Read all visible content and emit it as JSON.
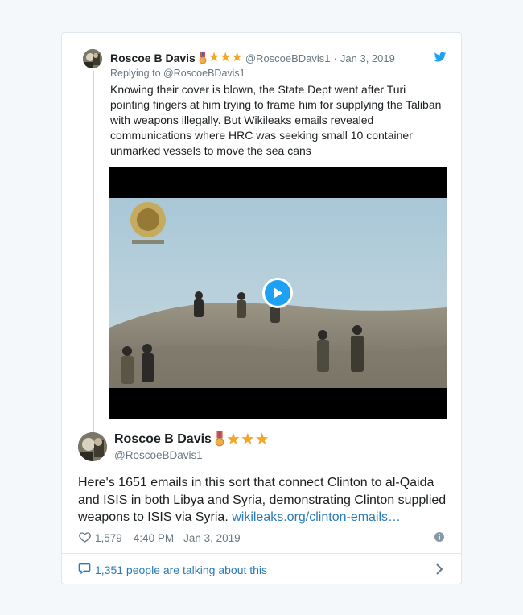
{
  "reply_tweet": {
    "author_name": "Roscoe B Davis",
    "handle": "@RoscoeBDavis1",
    "separator": "·",
    "date": "Jan 3, 2019",
    "replying_to": "Replying to @RoscoeBDavis1",
    "text": "Knowing their cover is blown, the State Dept went after Turi pointing  fingers at him trying to frame him for supplying the Taliban with weapons illegally. But Wikileaks emails revealed communications where  HRC was seeking small 10 container unmarked vessels to move the sea cans",
    "stars": "★★★"
  },
  "main_tweet": {
    "author_name": "Roscoe B Davis",
    "handle": "@RoscoeBDavis1",
    "stars": "★★★",
    "text": "Here's 1651 emails in this sort that connect Clinton to al-Qaida and ISIS in both Libya and Syria, demonstrating Clinton supplied weapons to ISIS via Syria. ",
    "link_text": "wikileaks.org/clinton-emails…",
    "likes": "1,579",
    "timestamp": "4:40 PM - Jan 3, 2019"
  },
  "footer": {
    "talking_label": "1,351 people are talking about this"
  },
  "icons": {
    "brand": "twitter-bird-icon",
    "like": "heart-icon",
    "info": "info-icon",
    "reply": "speech-bubble-icon",
    "more": "chevron-right-icon",
    "media": "play-icon"
  },
  "colors": {
    "accent": "#1da1f2",
    "link": "#2b7bb9",
    "star": "#f5a623",
    "muted": "#697882"
  }
}
